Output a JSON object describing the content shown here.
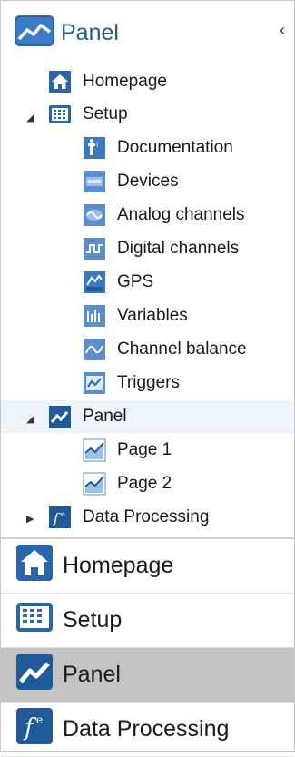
{
  "header": {
    "title": "Panel",
    "collapse_glyph": "‹"
  },
  "tree": {
    "homepage": "Homepage",
    "setup": "Setup",
    "setup_children": [
      "Documentation",
      "Devices",
      "Analog channels",
      "Digital channels",
      "GPS",
      "Variables",
      "Channel balance",
      "Triggers"
    ],
    "panel": "Panel",
    "panel_children": [
      "Page 1",
      "Page 2"
    ],
    "data_processing": "Data Processing"
  },
  "bottom_nav": [
    "Homepage",
    "Setup",
    "Panel",
    "Data Processing"
  ],
  "colors": {
    "brand": "#1f5a9a",
    "active": "#c4c4c4",
    "icon_blue": "#2a66b0"
  }
}
